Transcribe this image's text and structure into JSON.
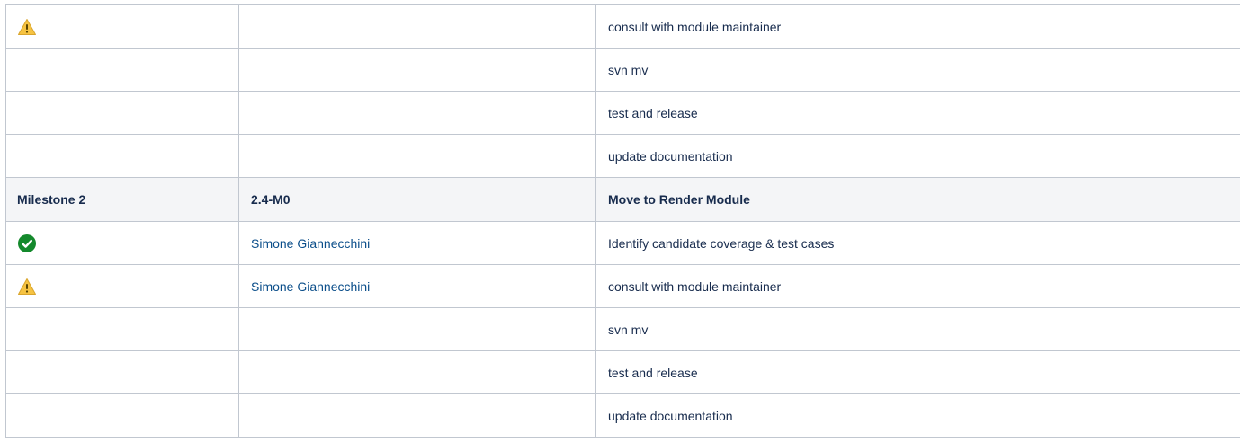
{
  "rows": [
    {
      "status_icon": "warning-icon",
      "assignee": "",
      "task": "consult with module maintainer"
    },
    {
      "status_icon": "",
      "assignee": "",
      "task": "svn mv"
    },
    {
      "status_icon": "",
      "assignee": "",
      "task": "test and release"
    },
    {
      "status_icon": "",
      "assignee": "",
      "task": "update documentation"
    },
    {
      "header": true,
      "milestone": "Milestone 2",
      "version": "2.4-M0",
      "title": "Move to Render Module"
    },
    {
      "status_icon": "check-icon",
      "assignee": "Simone Giannecchini",
      "task": "Identify candidate coverage & test cases"
    },
    {
      "status_icon": "warning-icon",
      "assignee": "Simone Giannecchini",
      "task": "consult with module maintainer"
    },
    {
      "status_icon": "",
      "assignee": "",
      "task": "svn mv"
    },
    {
      "status_icon": "",
      "assignee": "",
      "task": "test and release"
    },
    {
      "status_icon": "",
      "assignee": "",
      "task": "update documentation"
    }
  ],
  "colors": {
    "border": "#c1c7d0",
    "header_bg": "#f4f5f7",
    "link": "#0b4e8a",
    "warning": "#f6c342",
    "success": "#14892c"
  }
}
